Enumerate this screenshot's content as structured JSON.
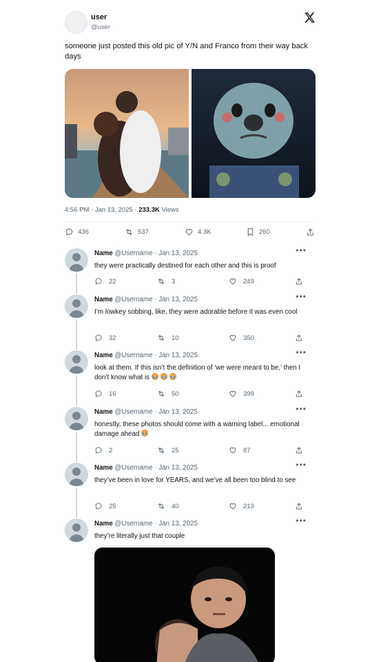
{
  "post": {
    "author_name": "user",
    "author_handle": "@user",
    "text": "someone just posted this old pic of Y/N and Franco from their way back days",
    "time": "4:56 PM · Jan 13, 2025 · ",
    "views_count": "233.3K",
    "views_label": " Views",
    "stats": {
      "replies": "436",
      "reposts": "537",
      "likes": "4.3K",
      "bookmarks": "260"
    }
  },
  "replies": [
    {
      "name": "Name",
      "meta": "@Username · Jan 13, 2025",
      "text": "they were practically destined for each other and this is proof",
      "replies": "22",
      "reposts": "3",
      "likes": "249"
    },
    {
      "name": "Name",
      "meta": "@Username · Jan 13, 2025",
      "text": "I’m lowkey sobbing, like, they were adorable before it was even cool",
      "replies": "32",
      "reposts": "10",
      "likes": "350"
    },
    {
      "name": "Name",
      "meta": "@Username · Jan 13, 2025",
      "text": "look at them. If this isn’t the definition of ‘we were meant to be,’ then I don’t know what is",
      "replies": "16",
      "reposts": "50",
      "likes": "399"
    },
    {
      "name": "Name",
      "meta": "@Username · Jan 13, 2025",
      "text": "honestly, these photos should come with a warning label... emotional damage ahead",
      "replies": "2",
      "reposts": "25",
      "likes": "87"
    },
    {
      "name": "Name",
      "meta": "@Username · Jan 13, 2025",
      "text": "they’ve been in love for YEARS, and we’ve all been too blind to see",
      "replies": "25",
      "reposts": "40",
      "likes": "213"
    },
    {
      "name": "Name",
      "meta": "@Username · Jan 13, 2025",
      "text": "they’re literally just that couple"
    }
  ],
  "icons": {
    "x_logo": "x-logo-icon",
    "reply": "reply-icon",
    "repost": "repost-icon",
    "like": "heart-icon",
    "bookmark": "bookmark-icon",
    "share": "share-icon",
    "more": "more-icon",
    "emoji": "crying-face-emoji"
  },
  "colors": {
    "text": "#0f1419",
    "secondary": "#536471",
    "divider": "#eff3f4",
    "avatar": "#cfd9de"
  }
}
